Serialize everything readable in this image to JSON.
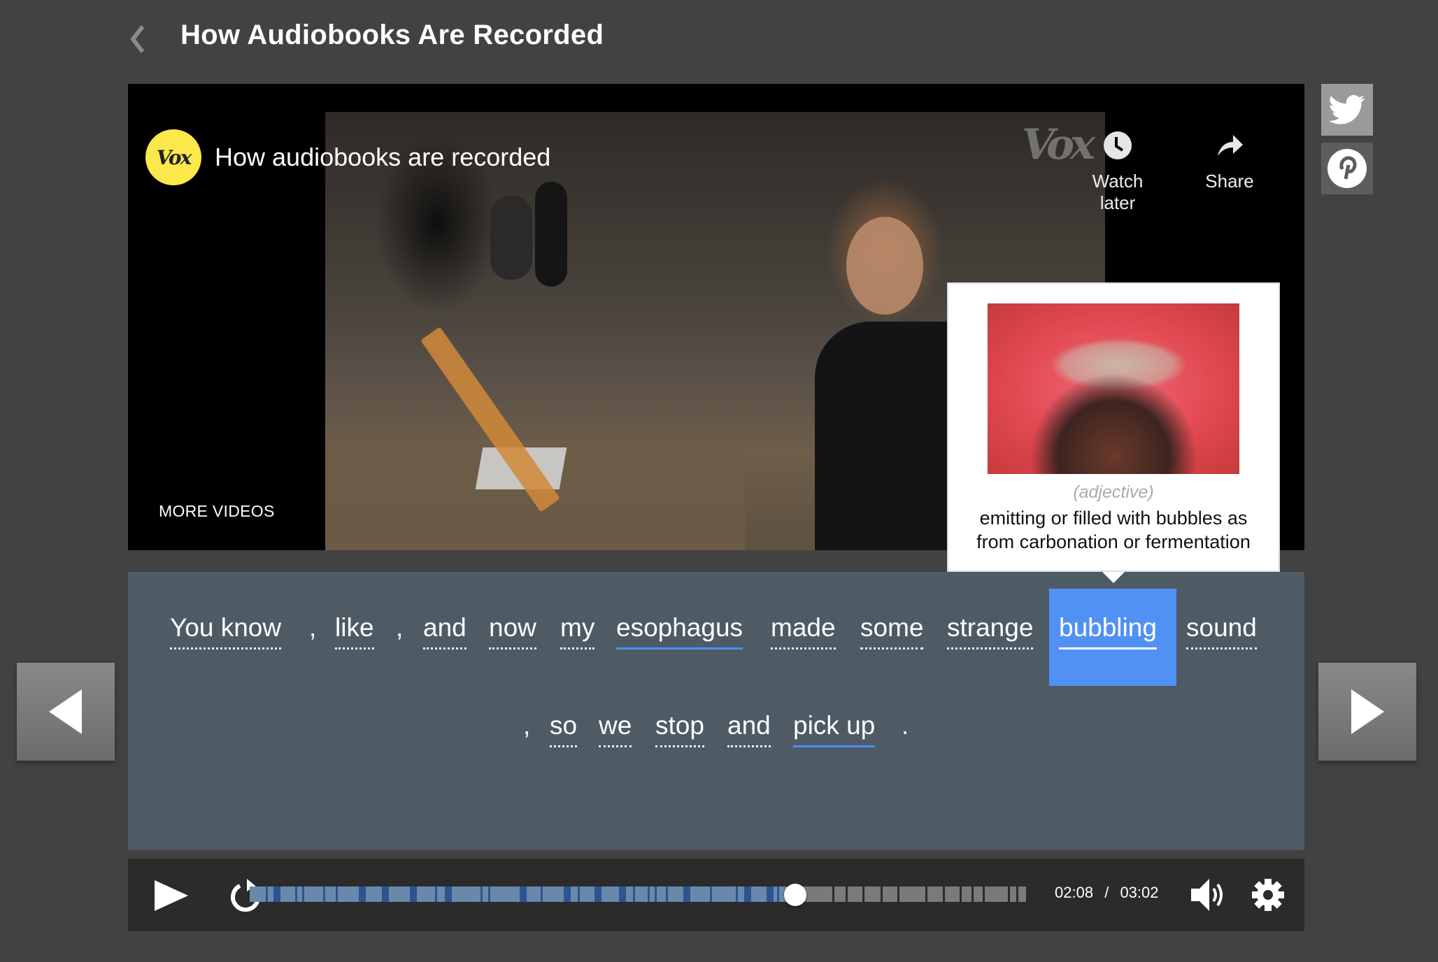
{
  "header": {
    "title": "How Audiobooks Are Recorded",
    "back_icon": "chevron-left-icon"
  },
  "video": {
    "channel_logo": "Vox",
    "title": "How audiobooks are recorded",
    "watermark": "Vox",
    "watch_later_label": "Watch later",
    "share_label": "Share",
    "more_videos_label": "MORE VIDEOS"
  },
  "social": [
    {
      "name": "twitter",
      "icon": "twitter-icon"
    },
    {
      "name": "pinterest",
      "icon": "pinterest-icon"
    }
  ],
  "transcript": {
    "line1": [
      {
        "text": "You know",
        "type": "word",
        "state": "normal"
      },
      {
        "text": ",",
        "type": "punct"
      },
      {
        "text": "like",
        "type": "word",
        "state": "normal"
      },
      {
        "text": ",",
        "type": "punct"
      },
      {
        "text": "and",
        "type": "word",
        "state": "normal"
      },
      {
        "text": "now",
        "type": "word",
        "state": "normal"
      },
      {
        "text": "my",
        "type": "word",
        "state": "normal"
      },
      {
        "text": "esophagus",
        "type": "word",
        "state": "learned"
      },
      {
        "text": "made",
        "type": "word",
        "state": "normal"
      },
      {
        "text": "some",
        "type": "word",
        "state": "normal"
      },
      {
        "text": "strange",
        "type": "word",
        "state": "normal"
      },
      {
        "text": "bubbling",
        "type": "word",
        "state": "active"
      },
      {
        "text": "sound",
        "type": "word",
        "state": "normal"
      }
    ],
    "line2": [
      {
        "text": ",",
        "type": "punct"
      },
      {
        "text": "so",
        "type": "word",
        "state": "normal"
      },
      {
        "text": "we",
        "type": "word",
        "state": "normal"
      },
      {
        "text": "stop",
        "type": "word",
        "state": "normal"
      },
      {
        "text": "and",
        "type": "word",
        "state": "normal"
      },
      {
        "text": "pick up",
        "type": "word",
        "state": "learned"
      },
      {
        "text": ".",
        "type": "punct"
      }
    ]
  },
  "definition_popup": {
    "word": "bubbling",
    "part_of_speech": "(adjective)",
    "definition": "emitting or filled with bubbles as from carbonation or fermentation"
  },
  "player": {
    "current_time": "02:08",
    "separator": "/",
    "duration": "03:02",
    "progress_fraction": 0.703,
    "play_icon": "play-icon",
    "replay_icon": "replay-icon",
    "volume_icon": "volume-icon",
    "settings_icon": "gear-icon"
  },
  "colors": {
    "accent_blue": "#5191f4",
    "learned_underline": "#4e8ef0",
    "played_segment": "#6a88ab",
    "played_boundary": "#2a5591",
    "unplayed_segment": "#7a7a7a",
    "transcript_bg": "#4e5b65",
    "vox_yellow": "#fbe84a"
  },
  "navigation": {
    "prev_icon": "triangle-left-icon",
    "next_icon": "triangle-right-icon"
  }
}
